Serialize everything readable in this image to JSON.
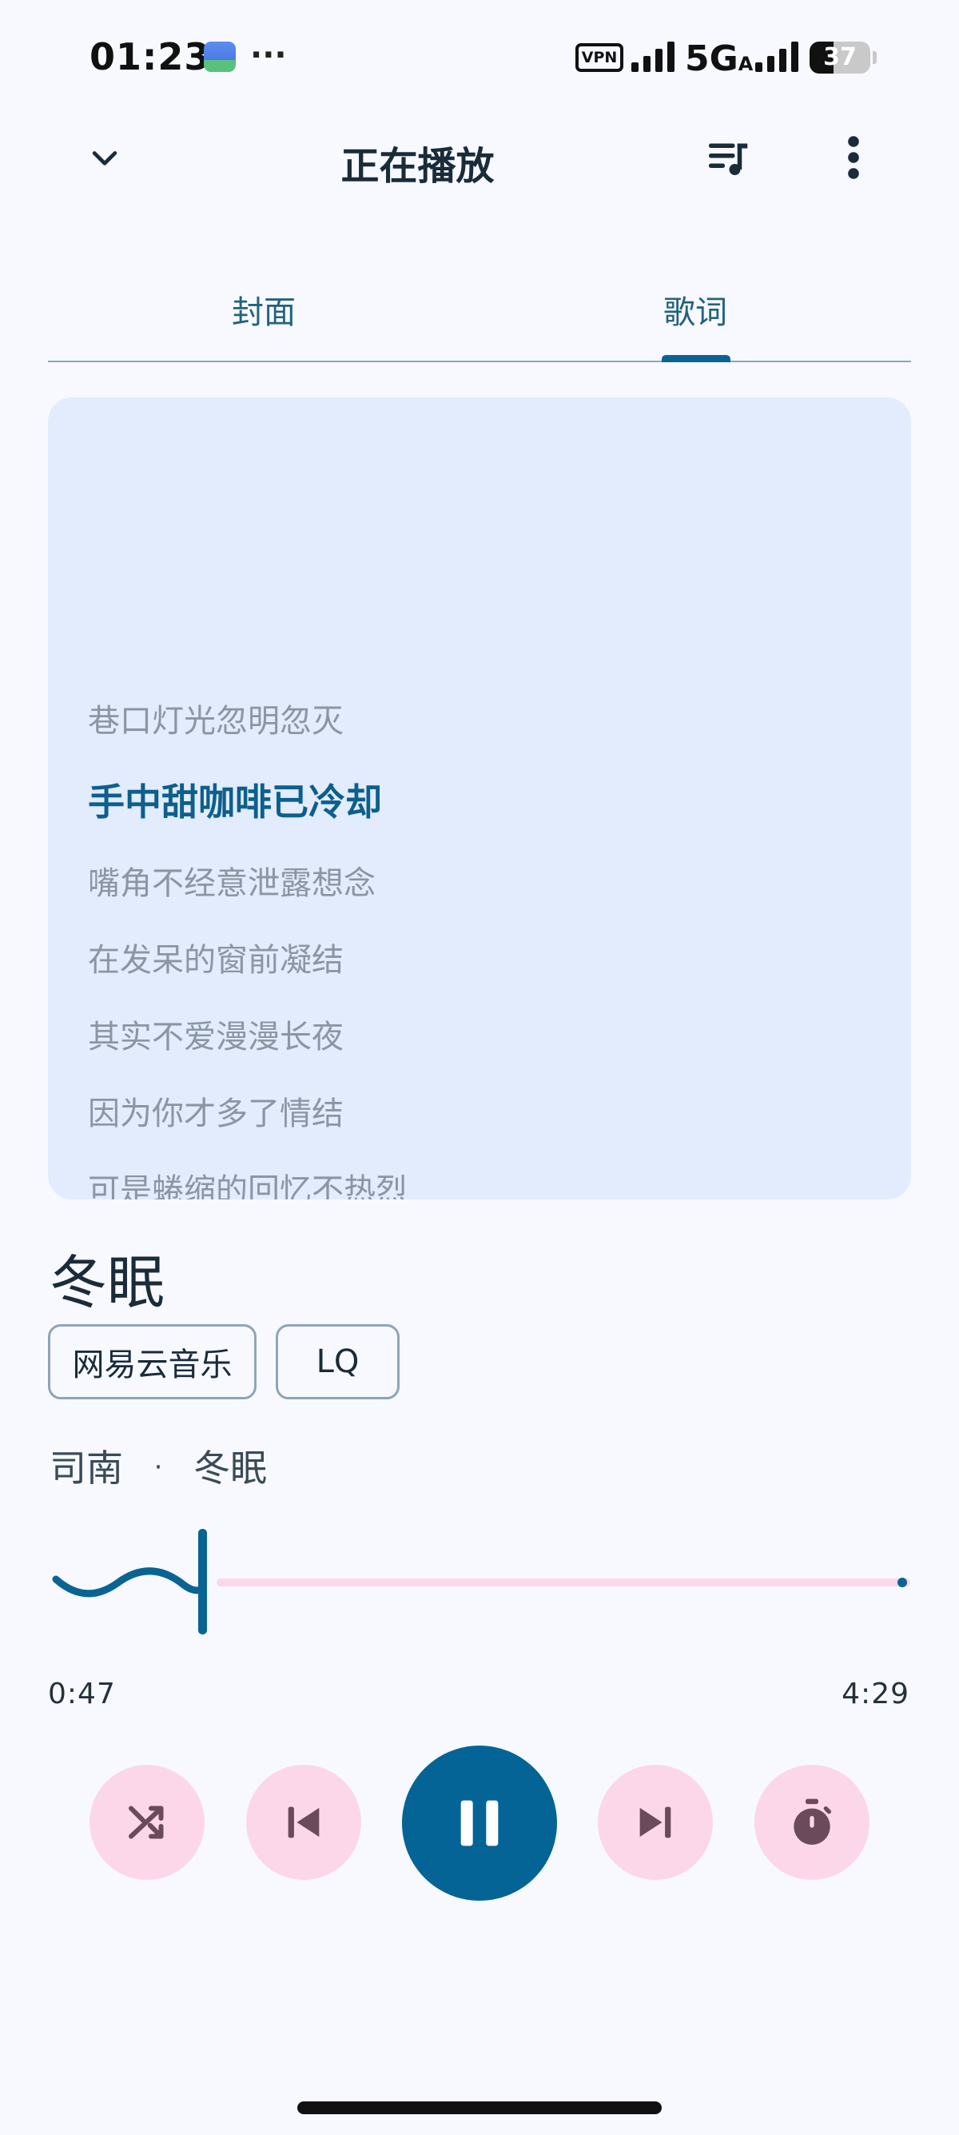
{
  "status_bar": {
    "time": "01:23",
    "dots": "···",
    "vpn": "VPN",
    "network": "5G",
    "network_suffix": "A",
    "battery": "37"
  },
  "header": {
    "title": "正在播放"
  },
  "tabs": [
    {
      "label": "封面"
    },
    {
      "label": "歌词"
    }
  ],
  "lyrics": [
    "巷口灯光忽明忽灭",
    "手中甜咖啡已冷却",
    "嘴角不经意泄露想念",
    "在发呆的窗前凝结",
    "其实不爱漫漫长夜",
    "因为你才多了情结",
    "可是蜷缩的回忆不热烈"
  ],
  "song": {
    "title": "冬眠",
    "tags": [
      "网易云音乐",
      "LQ"
    ],
    "artist": "司南",
    "separator": "·",
    "album": "冬眠"
  },
  "progress": {
    "elapsed": "0:47",
    "total": "4:29",
    "fraction": 0.175
  },
  "colors": {
    "accent": "#046495",
    "button_bg": "#fcd7ea",
    "icon_dark": "#6b4a5c",
    "card_bg": "#e2ecfd"
  },
  "icons": {
    "collapse": "chevron-down-icon",
    "queue": "queue-music-icon",
    "more": "more-vert-icon",
    "shuffle": "shuffle-icon",
    "previous": "skip-previous-icon",
    "pause": "pause-icon",
    "next": "skip-next-icon",
    "timer": "timer-icon"
  }
}
